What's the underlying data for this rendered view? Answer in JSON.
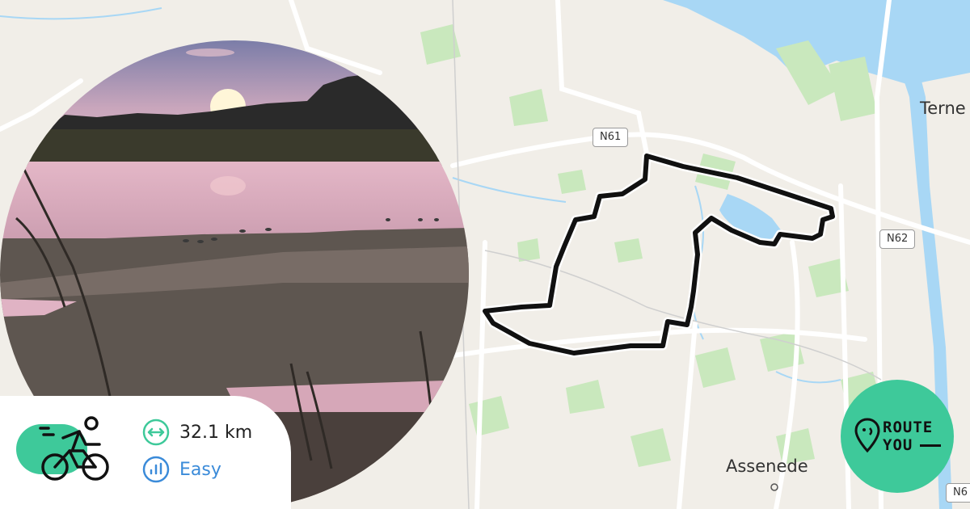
{
  "map": {
    "roads": {
      "n61": "N61",
      "n62": "N62",
      "n6_partial": "N6"
    },
    "places": {
      "terneuzen_partial": "Terne",
      "assenede": "Assenede"
    }
  },
  "route": {
    "distance": "32.1 km",
    "difficulty": "Easy"
  },
  "icons": {
    "activity": "cyclist-icon",
    "distance": "distance-arrows-icon",
    "difficulty": "bar-chart-icon",
    "brand": "routeyou-pin-icon"
  },
  "brand": {
    "line1": "ROUTE",
    "line2": "YOU"
  },
  "colors": {
    "land": "#f1eee8",
    "water": "#a8d7f5",
    "green": "#c9e8bd",
    "route": "#111111",
    "accent": "#3ec99a",
    "difficulty": "#3b8bd9"
  }
}
